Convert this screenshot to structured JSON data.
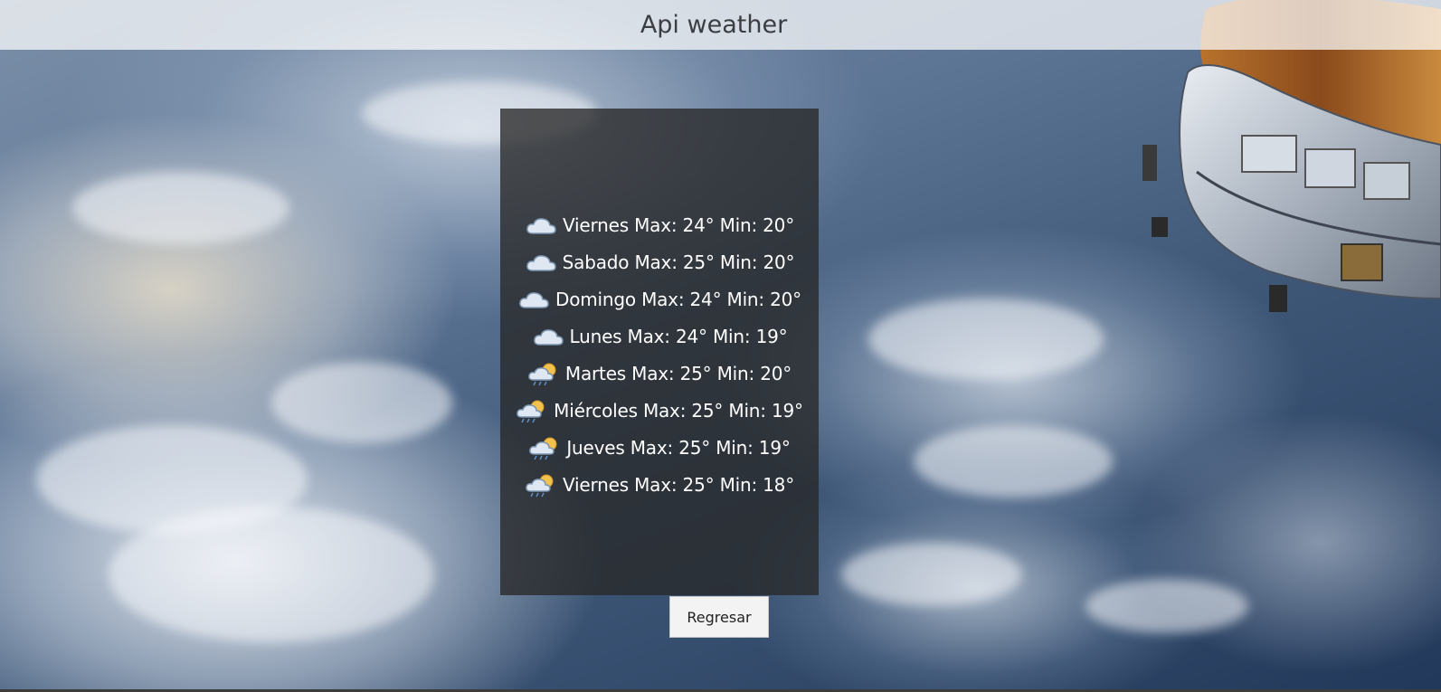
{
  "header": {
    "title": "Api weather"
  },
  "forecast": [
    {
      "text": "Viernes Max: 24° Min: 20°",
      "icon": "cloudy-icon"
    },
    {
      "text": "Sabado Max: 25° Min: 20°",
      "icon": "cloudy-icon"
    },
    {
      "text": "Domingo Max: 24° Min: 20°",
      "icon": "cloudy-icon"
    },
    {
      "text": "Lunes Max: 24° Min: 19°",
      "icon": "cloudy-icon"
    },
    {
      "text": "Martes Max: 25° Min: 20°",
      "icon": "partly-cloudy-rain-icon"
    },
    {
      "text": "Miércoles Max: 25° Min: 19°",
      "icon": "partly-cloudy-rain-icon"
    },
    {
      "text": "Jueves Max: 25° Min: 19°",
      "icon": "partly-cloudy-rain-icon"
    },
    {
      "text": "Viernes Max: 25° Min: 18°",
      "icon": "partly-cloudy-rain-icon"
    }
  ],
  "back_button": {
    "label": "Regresar"
  },
  "colors": {
    "panel_background": "#282828",
    "header_background": "#ffffff",
    "text": "#ffffff"
  }
}
